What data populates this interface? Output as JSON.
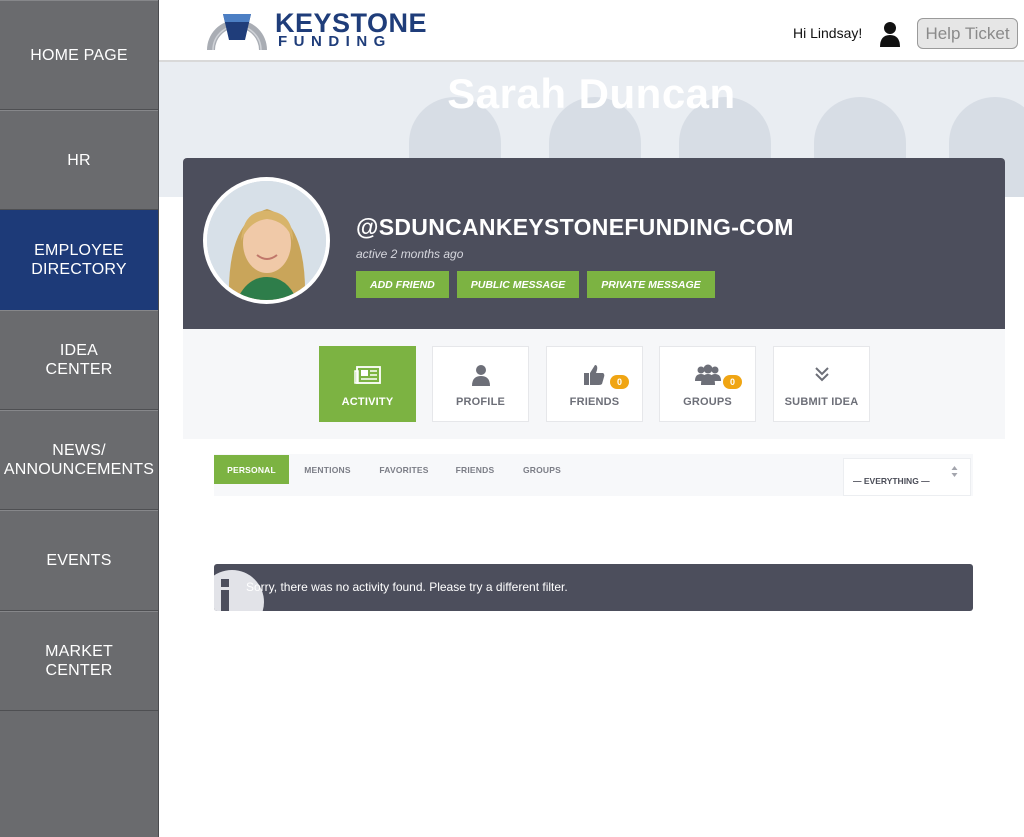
{
  "sidebar": {
    "items": [
      {
        "lines": [
          "HOME PAGE"
        ],
        "active": false
      },
      {
        "lines": [
          "HR"
        ],
        "active": false
      },
      {
        "lines": [
          "EMPLOYEE",
          "DIRECTORY"
        ],
        "active": true
      },
      {
        "lines": [
          "IDEA",
          "CENTER"
        ],
        "active": false
      },
      {
        "lines": [
          "NEWS/",
          "ANNOUNCEMENTS"
        ],
        "active": false
      },
      {
        "lines": [
          "EVENTS"
        ],
        "active": false
      },
      {
        "lines": [
          "MARKET",
          "CENTER"
        ],
        "active": false
      }
    ]
  },
  "header": {
    "logo_word1": "KEYSTONE",
    "logo_word2": "FUNDING",
    "greeting": "Hi Lindsay!",
    "help_label": "Help Ticket"
  },
  "banner": {
    "title": "Sarah Duncan"
  },
  "profile": {
    "handle": "@SDUNCANKEYSTONEFUNDING-COM",
    "active": "active 2 months ago",
    "actions": [
      "ADD FRIEND",
      "PUBLIC MESSAGE",
      "PRIVATE MESSAGE"
    ]
  },
  "tabs": [
    {
      "label": "ACTIVITY",
      "icon": "newspaper-icon",
      "active": true
    },
    {
      "label": "PROFILE",
      "icon": "person-icon",
      "active": false
    },
    {
      "label": "FRIENDS",
      "icon": "thumbs-up-icon",
      "badge": "0",
      "active": false
    },
    {
      "label": "GROUPS",
      "icon": "group-icon",
      "badge": "0",
      "active": false
    },
    {
      "label": "SUBMIT IDEA",
      "icon": "double-chevron-down-icon",
      "active": false
    }
  ],
  "subnav": {
    "items": [
      "PERSONAL",
      "MENTIONS",
      "FAVORITES",
      "FRIENDS",
      "GROUPS"
    ],
    "filter": "— EVERYTHING —"
  },
  "notice": {
    "text": "Sorry, there was no activity found. Please try a different filter."
  },
  "colors": {
    "accent": "#7cb342",
    "sidebar": "#6a6b6e",
    "sidebar_active": "#1d3a78",
    "dark": "#4c4e5c",
    "badge": "#f0a513"
  }
}
